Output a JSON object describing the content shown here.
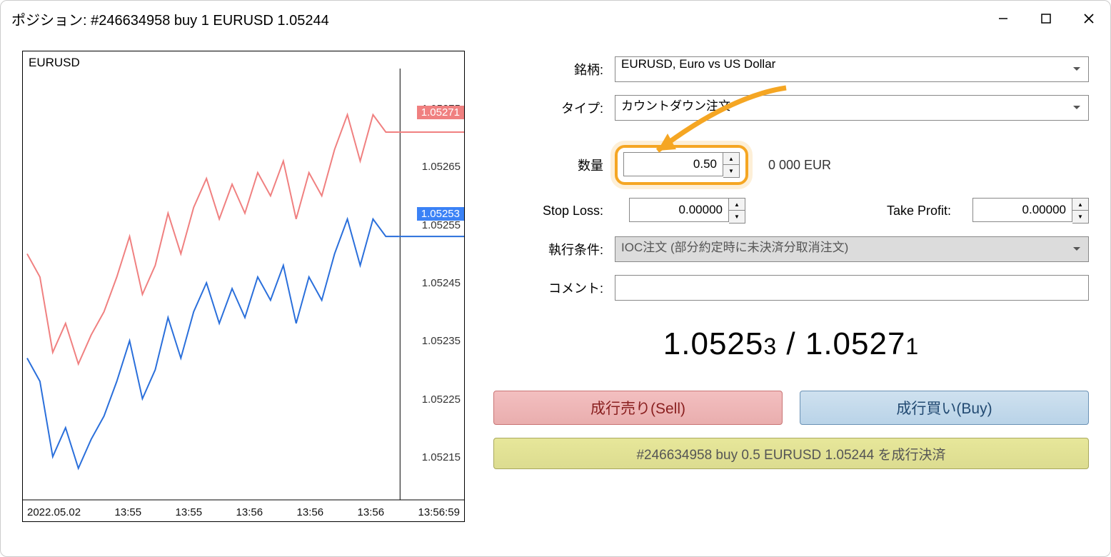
{
  "window_title": "ポジション: #246634958 buy 1 EURUSD 1.05244",
  "chart": {
    "symbol": "EURUSD",
    "y_ticks": [
      "1.05275",
      "1.05265",
      "1.05255",
      "1.05245",
      "1.05235",
      "1.05225",
      "1.05215"
    ],
    "ask_tag": "1.05271",
    "bid_tag": "1.05253",
    "x_ticks": [
      "2022.05.02",
      "13:55",
      "13:55",
      "13:56",
      "13:56",
      "13:56",
      "13:56:59"
    ]
  },
  "labels": {
    "symbol": "銘柄:",
    "type": "タイプ:",
    "volume": "数量",
    "stop_loss": "Stop Loss:",
    "take_profit": "Take Profit:",
    "fill_policy": "執行条件:",
    "comment": "コメント:"
  },
  "fields": {
    "symbol_value": "EURUSD, Euro vs US Dollar",
    "type_value": "カウントダウン注文",
    "volume_value": "0.50",
    "volume_suffix": "0 000 EUR",
    "stop_loss_value": "0.00000",
    "take_profit_value": "0.00000",
    "fill_policy_value": "IOC注文 (部分約定時に未決済分取消注文)",
    "comment_value": ""
  },
  "price_display": {
    "bid_main": "1.0525",
    "bid_last": "3",
    "sep": " / ",
    "ask_main": "1.0527",
    "ask_last": "1"
  },
  "buttons": {
    "sell": "成行売り(Sell)",
    "buy": "成行買い(Buy)",
    "close_position": "#246634958 buy 0.5 EURUSD 1.05244 を成行決済"
  },
  "chart_data": {
    "type": "line",
    "title": "EURUSD",
    "xlabel": "",
    "ylabel": "",
    "ylim": [
      1.0521,
      1.0528
    ],
    "x": [
      0,
      1,
      2,
      3,
      4,
      5,
      6,
      7,
      8,
      9,
      10,
      11,
      12,
      13,
      14,
      15,
      16,
      17,
      18,
      19,
      20,
      21,
      22,
      23,
      24,
      25,
      26,
      27,
      28,
      29
    ],
    "series": [
      {
        "name": "bid",
        "color": "#2a6fdb",
        "values": [
          1.05232,
          1.05228,
          1.05215,
          1.0522,
          1.05213,
          1.05218,
          1.05222,
          1.05228,
          1.05235,
          1.05225,
          1.0523,
          1.05239,
          1.05232,
          1.0524,
          1.05245,
          1.05238,
          1.05244,
          1.05239,
          1.05246,
          1.05242,
          1.05248,
          1.05238,
          1.05246,
          1.05242,
          1.0525,
          1.05256,
          1.05248,
          1.05256,
          1.05253,
          1.05253
        ]
      },
      {
        "name": "ask",
        "color": "#f08080",
        "values": [
          1.0525,
          1.05246,
          1.05233,
          1.05238,
          1.05231,
          1.05236,
          1.0524,
          1.05246,
          1.05253,
          1.05243,
          1.05248,
          1.05257,
          1.0525,
          1.05258,
          1.05263,
          1.05256,
          1.05262,
          1.05257,
          1.05264,
          1.0526,
          1.05266,
          1.05256,
          1.05264,
          1.0526,
          1.05268,
          1.05274,
          1.05266,
          1.05274,
          1.05271,
          1.05271
        ]
      }
    ],
    "x_tick_labels": [
      "2022.05.02",
      "13:55",
      "13:55",
      "13:56",
      "13:56",
      "13:56",
      "13:56:59"
    ]
  }
}
